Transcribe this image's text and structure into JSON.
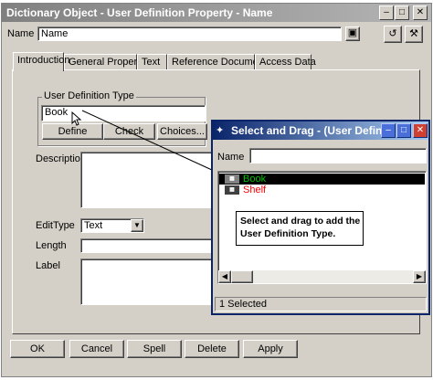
{
  "main_window": {
    "title": "Dictionary Object - User Definition Property - Name",
    "name_label": "Name",
    "name_value": "Name",
    "tabs": [
      {
        "label": "Introduction"
      },
      {
        "label": "General Properties"
      },
      {
        "label": "Text"
      },
      {
        "label": "Reference Documents"
      },
      {
        "label": "Access Data"
      }
    ],
    "udt_group_label": "User Definition Type",
    "udt_value": "Book",
    "define_button": "Define",
    "check_button": "Check",
    "choices_button": "Choices...",
    "description_label": "Description",
    "edittype_label": "EditType",
    "edittype_value": "Text",
    "length_label": "Length",
    "label_label": "Label",
    "bottom_buttons": {
      "ok": "OK",
      "cancel": "Cancel",
      "spell": "Spell",
      "delete": "Delete",
      "apply": "Apply"
    }
  },
  "popup": {
    "title": "Select and Drag - (User Defini...",
    "name_label": "Name",
    "items": [
      {
        "icon": "table-icon",
        "label": "Book",
        "color": "#00c000",
        "selected": true
      },
      {
        "icon": "table-icon",
        "label": "Shelf",
        "color": "#ff0000",
        "selected": false
      }
    ],
    "status": "1 Selected"
  },
  "callout": {
    "line1": "Select and drag to add the",
    "line2": "User Definition Type."
  },
  "colors": {
    "popup_title": "#0a246a",
    "face": "#d4d0c8"
  }
}
